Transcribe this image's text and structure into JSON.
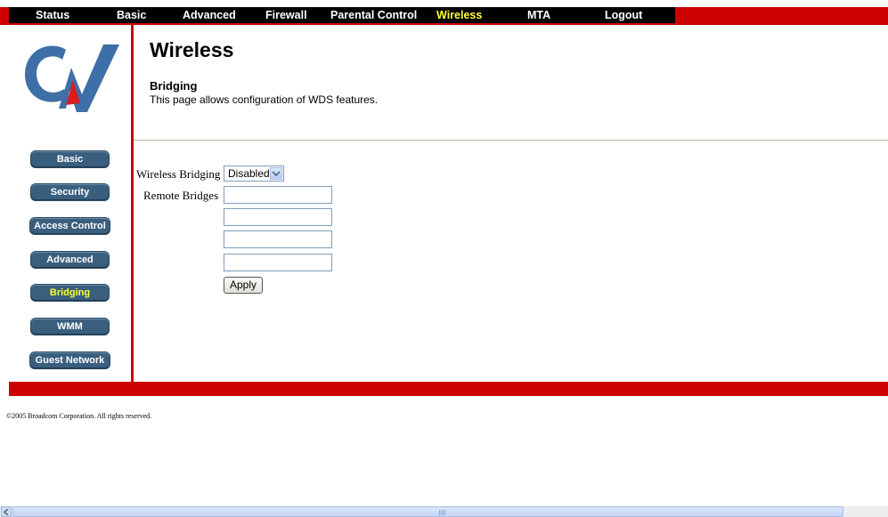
{
  "topnav": {
    "items": [
      {
        "label": "Status"
      },
      {
        "label": "Basic"
      },
      {
        "label": "Advanced"
      },
      {
        "label": "Firewall"
      },
      {
        "label": "Parental Control"
      },
      {
        "label": "Wireless",
        "active": true
      },
      {
        "label": "MTA"
      },
      {
        "label": "Logout"
      }
    ]
  },
  "sidebar": {
    "items": [
      {
        "label": "Basic"
      },
      {
        "label": "Security"
      },
      {
        "label": "Access Control"
      },
      {
        "label": "Advanced"
      },
      {
        "label": "Bridging",
        "active": true
      },
      {
        "label": "WMM"
      },
      {
        "label": "Guest Network"
      }
    ]
  },
  "header": {
    "title": "Wireless",
    "section_title": "Bridging",
    "section_desc": "This page allows configuration of WDS features."
  },
  "form": {
    "bridging_label": "Wireless Bridging",
    "bridging_value": "Disabled",
    "remote_label": "Remote Bridges",
    "remote_values": [
      "",
      "",
      "",
      ""
    ],
    "apply_label": "Apply"
  },
  "footer": {
    "copyright": "©2005 Broadcom Corporation. All rights reserved."
  },
  "colors": {
    "brand_red": "#cc0000",
    "nav_black": "#000000",
    "active_yellow": "#ffff33",
    "sidebar_blue": "#3a5f7e",
    "logo_blue": "#3e6fa6"
  }
}
